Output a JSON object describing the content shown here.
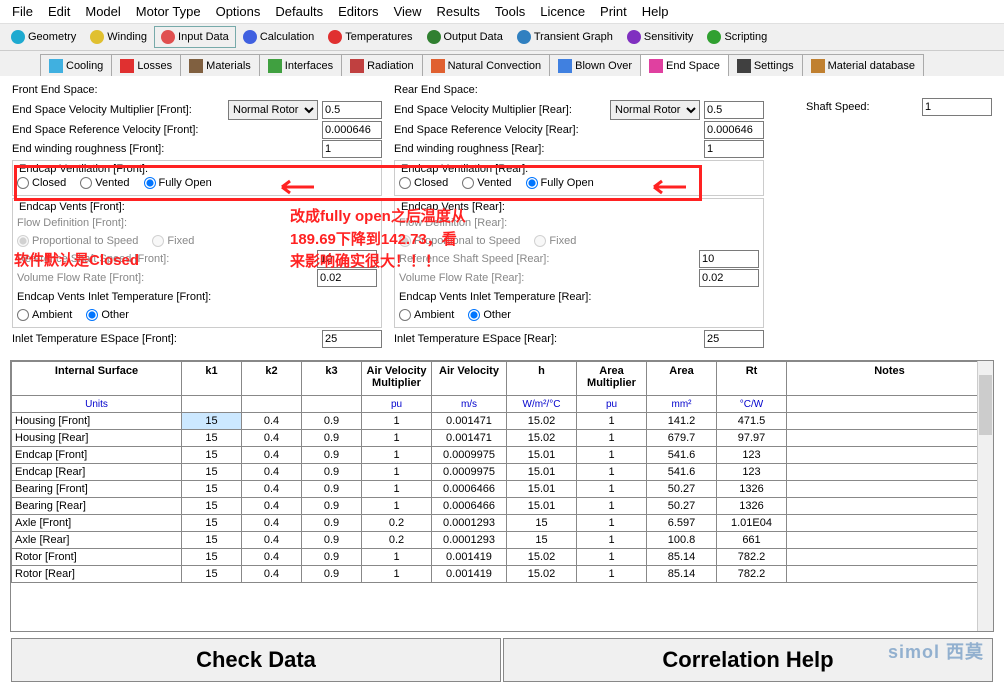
{
  "menu": [
    "File",
    "Edit",
    "Model",
    "Motor Type",
    "Options",
    "Defaults",
    "Editors",
    "View",
    "Results",
    "Tools",
    "Licence",
    "Print",
    "Help"
  ],
  "toolbar": [
    {
      "label": "Geometry",
      "color": "#1eaad0"
    },
    {
      "label": "Winding",
      "color": "#e0c030"
    },
    {
      "label": "Input Data",
      "color": "#e05050",
      "active": true
    },
    {
      "label": "Calculation",
      "color": "#4060e0"
    },
    {
      "label": "Temperatures",
      "color": "#e03030"
    },
    {
      "label": "Output Data",
      "color": "#308030"
    },
    {
      "label": "Transient Graph",
      "color": "#3080c0"
    },
    {
      "label": "Sensitivity",
      "color": "#8030c0"
    },
    {
      "label": "Scripting",
      "color": "#30a030"
    }
  ],
  "tabs": [
    {
      "label": "Cooling",
      "color": "#40b0e0"
    },
    {
      "label": "Losses",
      "color": "#e03030"
    },
    {
      "label": "Materials",
      "color": "#806040"
    },
    {
      "label": "Interfaces",
      "color": "#40a040"
    },
    {
      "label": "Radiation",
      "color": "#c04040"
    },
    {
      "label": "Natural Convection",
      "color": "#e06030"
    },
    {
      "label": "Blown Over",
      "color": "#4080e0"
    },
    {
      "label": "End Space",
      "color": "#e040a0",
      "active": true
    },
    {
      "label": "Settings",
      "color": "#404040"
    },
    {
      "label": "Material database",
      "color": "#c08030"
    }
  ],
  "front": {
    "title": "Front End Space:",
    "velmult_lbl": "End Space Velocity Multiplier [Front]:",
    "velmult_sel": "Normal Rotor",
    "velmult_val": "0.5",
    "refvel_lbl": "End Space Reference Velocity [Front]:",
    "refvel_val": "0.000646",
    "rough_lbl": "End winding roughness [Front]:",
    "rough_val": "1",
    "endcap_vent_lbl": "Endcap Ventilation [Front]:",
    "vent_opts": [
      "Closed",
      "Vented",
      "Fully Open"
    ],
    "vents_title": "Endcap Vents [Front]:",
    "flowdef_lbl": "Flow Definition [Front]:",
    "flowdef_opts": [
      "Proportional to Speed",
      "Fixed"
    ],
    "refshaft_lbl": "Reference Shaft Speed [Front]:",
    "refshaft_val": "10",
    "volflow_lbl": "Volume Flow Rate [Front]:",
    "volflow_val": "0.02",
    "inlettemp_lbl": "Endcap Vents Inlet Temperature [Front]:",
    "inlettemp_opts": [
      "Ambient",
      "Other"
    ],
    "espacetemp_lbl": "Inlet Temperature ESpace [Front]:",
    "espacetemp_val": "25"
  },
  "rear": {
    "title": "Rear End Space:",
    "velmult_lbl": "End Space Velocity Multiplier [Rear]:",
    "velmult_sel": "Normal Rotor",
    "velmult_val": "0.5",
    "refvel_lbl": "End Space Reference Velocity [Rear]:",
    "refvel_val": "0.000646",
    "rough_lbl": "End winding roughness [Rear]:",
    "rough_val": "1",
    "endcap_vent_lbl": "Endcap Ventilation [Rear]:",
    "vents_title": "Endcap Vents [Rear]:",
    "flowdef_lbl": "Flow Definition [Rear]:",
    "refshaft_lbl": "Reference Shaft Speed [Rear]:",
    "refshaft_val": "10",
    "volflow_lbl": "Volume Flow Rate [Rear]:",
    "volflow_val": "0.02",
    "inlettemp_lbl": "Endcap Vents Inlet Temperature [Rear]:",
    "espacetemp_lbl": "Inlet Temperature ESpace [Rear]:",
    "espacetemp_val": "25"
  },
  "shaftspeed_lbl": "Shaft Speed:",
  "shaftspeed_val": "1",
  "table": {
    "headers": [
      "Internal Surface",
      "k1",
      "k2",
      "k3",
      "Air Velocity Multiplier",
      "Air Velocity",
      "h",
      "Area Multiplier",
      "Area",
      "Rt",
      "Notes"
    ],
    "units": [
      "Units",
      "",
      "",
      "",
      "pu",
      "m/s",
      "W/m²/°C",
      "pu",
      "mm²",
      "°C/W",
      ""
    ],
    "rows": [
      [
        "Housing [Front]",
        "15",
        "0.4",
        "0.9",
        "1",
        "0.001471",
        "15.02",
        "1",
        "141.2",
        "471.5",
        ""
      ],
      [
        "Housing [Rear]",
        "15",
        "0.4",
        "0.9",
        "1",
        "0.001471",
        "15.02",
        "1",
        "679.7",
        "97.97",
        ""
      ],
      [
        "Endcap [Front]",
        "15",
        "0.4",
        "0.9",
        "1",
        "0.0009975",
        "15.01",
        "1",
        "541.6",
        "123",
        ""
      ],
      [
        "Endcap [Rear]",
        "15",
        "0.4",
        "0.9",
        "1",
        "0.0009975",
        "15.01",
        "1",
        "541.6",
        "123",
        ""
      ],
      [
        "Bearing [Front]",
        "15",
        "0.4",
        "0.9",
        "1",
        "0.0006466",
        "15.01",
        "1",
        "50.27",
        "1326",
        ""
      ],
      [
        "Bearing [Rear]",
        "15",
        "0.4",
        "0.9",
        "1",
        "0.0006466",
        "15.01",
        "1",
        "50.27",
        "1326",
        ""
      ],
      [
        "Axle [Front]",
        "15",
        "0.4",
        "0.9",
        "0.2",
        "0.0001293",
        "15",
        "1",
        "6.597",
        "1.01E04",
        ""
      ],
      [
        "Axle [Rear]",
        "15",
        "0.4",
        "0.9",
        "0.2",
        "0.0001293",
        "15",
        "1",
        "100.8",
        "661",
        ""
      ],
      [
        "Rotor [Front]",
        "15",
        "0.4",
        "0.9",
        "1",
        "0.001419",
        "15.02",
        "1",
        "85.14",
        "782.2",
        ""
      ],
      [
        "Rotor [Rear]",
        "15",
        "0.4",
        "0.9",
        "1",
        "0.001419",
        "15.02",
        "1",
        "85.14",
        "782.2",
        ""
      ]
    ]
  },
  "buttons": {
    "check": "Check Data",
    "corr": "Correlation Help"
  },
  "anno_left": "软件默认是Closed",
  "anno_right": "改成fully open之后温度从189.69下降到142.73，看来影响确实很大！！！",
  "watermark": "simol 西莫"
}
